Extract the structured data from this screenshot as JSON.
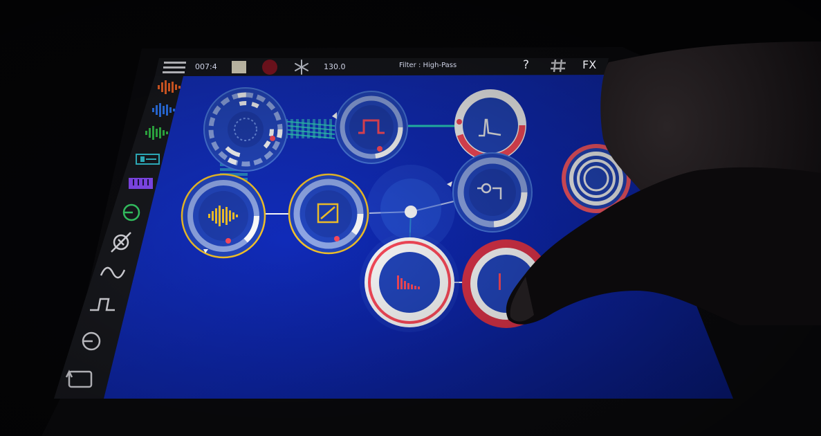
{
  "transport": {
    "position": "007:4",
    "tempo": "130.0",
    "status_text": "Filter : High-Pass"
  },
  "toolbar": {
    "help_label": "?",
    "grid_label": "#",
    "fx_label": "FX"
  },
  "sidebar": {
    "items": [
      {
        "icon": "waveform-icon",
        "color": "#ff6a2a"
      },
      {
        "icon": "waveform-icon",
        "color": "#2f7dff"
      },
      {
        "icon": "waveform-icon",
        "color": "#33c24a"
      },
      {
        "icon": "sampler-icon",
        "color": "#34c6d6"
      },
      {
        "icon": "keyboard-icon",
        "color": "#8b4dff"
      },
      {
        "icon": "input-icon",
        "color": "#38d46a"
      },
      {
        "icon": "random-icon",
        "color": "#e6e6ec"
      },
      {
        "icon": "lfo-sine-icon",
        "color": "#e6e6ec"
      },
      {
        "icon": "lfo-square-icon",
        "color": "#e6e6ec"
      },
      {
        "icon": "output-icon",
        "color": "#e6e6ec"
      },
      {
        "icon": "loop-icon",
        "color": "#e6e6ec"
      }
    ]
  },
  "nodes": [
    {
      "name": "sequencer-node",
      "icon": "sequencer-icon"
    },
    {
      "name": "oscillator-node",
      "icon": "square-wave-icon"
    },
    {
      "name": "filter-node",
      "icon": "high-pass-icon"
    },
    {
      "name": "sample-node",
      "icon": "waveform-icon"
    },
    {
      "name": "envelope-node",
      "icon": "envelope-icon"
    },
    {
      "name": "mixer-node",
      "icon": "mixer-icon"
    },
    {
      "name": "eq-node",
      "icon": "spectrum-icon"
    },
    {
      "name": "eq-node-2",
      "icon": "spectrum-icon"
    },
    {
      "name": "reverb-node",
      "icon": "reverb-icon"
    }
  ],
  "colors": {
    "canvas": "#0f2ab8",
    "accent_red": "#ff4b5c",
    "accent_yellow": "#f6c42a",
    "accent_teal": "#2de0c8",
    "ring_white": "#f4f4f4"
  }
}
